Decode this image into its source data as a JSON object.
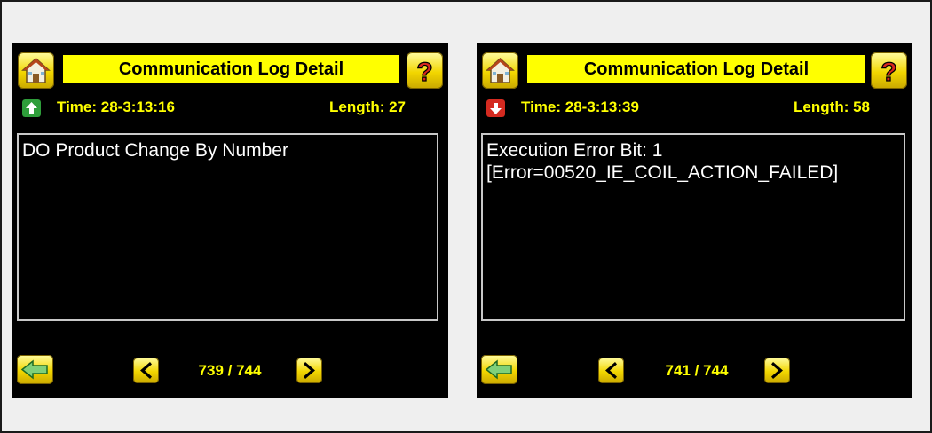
{
  "panels": [
    {
      "title": "Communication Log Detail",
      "direction_icon": "arrow-up-icon",
      "direction_color": "#2e9d3a",
      "time": "Time: 28-3:13:16",
      "length": "Length: 27",
      "message": "DO Product Change By Number",
      "page": "739 / 744"
    },
    {
      "title": "Communication Log Detail",
      "direction_icon": "arrow-down-icon",
      "direction_color": "#d42a20",
      "time": "Time: 28-3:13:39",
      "length": "Length: 58",
      "message": "Execution Error Bit: 1\n[Error=00520_IE_COIL_ACTION_FAILED]",
      "page": "741 / 744"
    }
  ],
  "colors": {
    "accent_yellow": "#ffff00",
    "button_yellow": "#f2d600",
    "screen_bg": "#000000",
    "page_bg": "#efefef"
  },
  "icons": {
    "home": "home-icon",
    "help": "help-icon",
    "back": "back-arrow-icon",
    "prev": "chevron-left-icon",
    "next": "chevron-right-icon"
  }
}
